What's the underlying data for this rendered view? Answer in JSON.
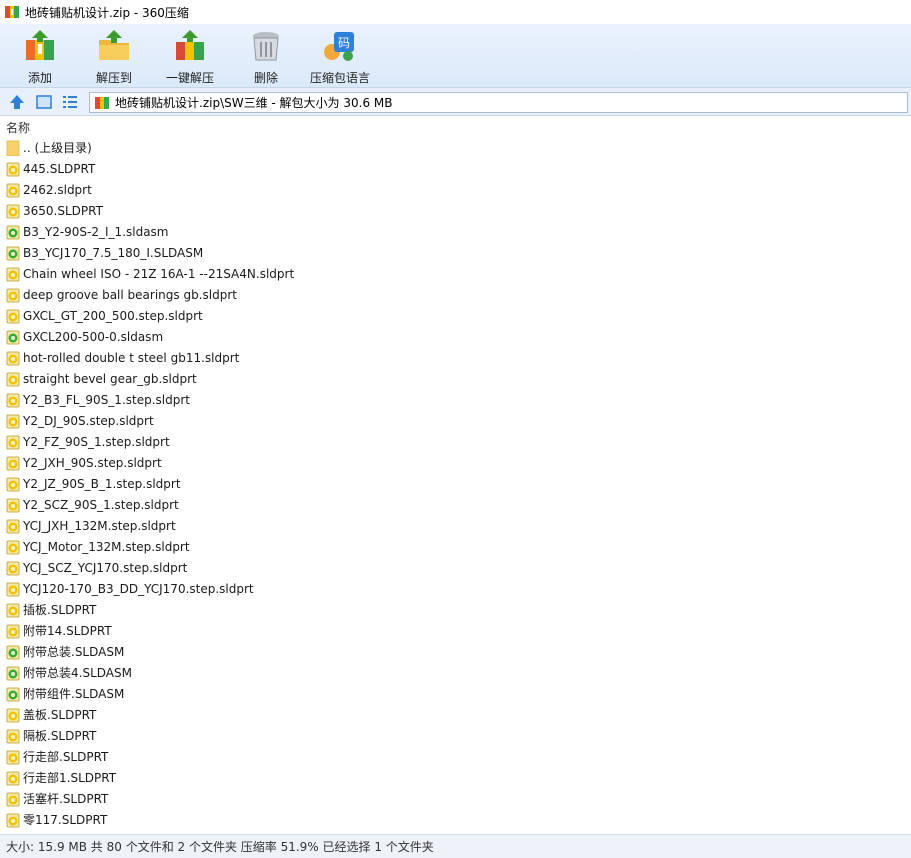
{
  "window": {
    "title": "地砖铺贴机设计.zip - 360压缩"
  },
  "toolbar": {
    "buttons": [
      {
        "id": "add",
        "label": "添加",
        "icon": "add-archive-icon"
      },
      {
        "id": "extract_to",
        "label": "解压到",
        "icon": "extract-folder-icon"
      },
      {
        "id": "one_click_extract",
        "label": "一键解压",
        "icon": "one-click-extract-icon"
      },
      {
        "id": "delete",
        "label": "删除",
        "icon": "trash-can-icon"
      },
      {
        "id": "language",
        "label": "压缩包语言",
        "icon": "encoding-icon",
        "badge": "码"
      }
    ]
  },
  "address": {
    "path": "地砖铺贴机设计.zip\\SW三维 - 解包大小为 30.6 MB"
  },
  "list": {
    "column_name": "名称",
    "parent_label": ".. (上级目录)",
    "files": [
      {
        "name": "445.SLDPRT",
        "type": "part"
      },
      {
        "name": "2462.sldprt",
        "type": "part"
      },
      {
        "name": "3650.SLDPRT",
        "type": "part"
      },
      {
        "name": "B3_Y2-90S-2_I_1.sldasm",
        "type": "asm"
      },
      {
        "name": "B3_YCJ170_7.5_180_I.SLDASM",
        "type": "asm"
      },
      {
        "name": "Chain wheel ISO - 21Z 16A-1 --21SA4N.sldprt",
        "type": "part"
      },
      {
        "name": "deep groove ball bearings gb.sldprt",
        "type": "part"
      },
      {
        "name": "GXCL_GT_200_500.step.sldprt",
        "type": "part"
      },
      {
        "name": "GXCL200-500-0.sldasm",
        "type": "asm"
      },
      {
        "name": "hot-rolled double t steel gb11.sldprt",
        "type": "part"
      },
      {
        "name": "straight bevel gear_gb.sldprt",
        "type": "part"
      },
      {
        "name": "Y2_B3_FL_90S_1.step.sldprt",
        "type": "part"
      },
      {
        "name": "Y2_DJ_90S.step.sldprt",
        "type": "part"
      },
      {
        "name": "Y2_FZ_90S_1.step.sldprt",
        "type": "part"
      },
      {
        "name": "Y2_JXH_90S.step.sldprt",
        "type": "part"
      },
      {
        "name": "Y2_JZ_90S_B_1.step.sldprt",
        "type": "part"
      },
      {
        "name": "Y2_SCZ_90S_1.step.sldprt",
        "type": "part"
      },
      {
        "name": "YCJ_JXH_132M.step.sldprt",
        "type": "part"
      },
      {
        "name": "YCJ_Motor_132M.step.sldprt",
        "type": "part"
      },
      {
        "name": "YCJ_SCZ_YCJ170.step.sldprt",
        "type": "part"
      },
      {
        "name": "YCJ120-170_B3_DD_YCJ170.step.sldprt",
        "type": "part"
      },
      {
        "name": "插板.SLDPRT",
        "type": "part"
      },
      {
        "name": "附带14.SLDPRT",
        "type": "part"
      },
      {
        "name": "附带总装.SLDASM",
        "type": "asm"
      },
      {
        "name": "附带总装4.SLDASM",
        "type": "asm"
      },
      {
        "name": "附带组件.SLDASM",
        "type": "asm"
      },
      {
        "name": "盖板.SLDPRT",
        "type": "part"
      },
      {
        "name": "隔板.SLDPRT",
        "type": "part"
      },
      {
        "name": "行走部.SLDPRT",
        "type": "part"
      },
      {
        "name": "行走部1.SLDPRT",
        "type": "part"
      },
      {
        "name": "活塞杆.SLDPRT",
        "type": "part"
      },
      {
        "name": "零117.SLDPRT",
        "type": "part"
      }
    ]
  },
  "status": {
    "text": "大小: 15.9 MB 共 80 个文件和 2 个文件夹 压缩率 51.9% 已经选择 1 个文件夹"
  },
  "colors": {
    "toolbar_bg": "#dbe9f9",
    "addressbar_bg": "#e8f1fb",
    "part_icon_accent": "#f2c200",
    "asm_icon_accent": "#2fae2f",
    "folder": "#f7d26b"
  }
}
